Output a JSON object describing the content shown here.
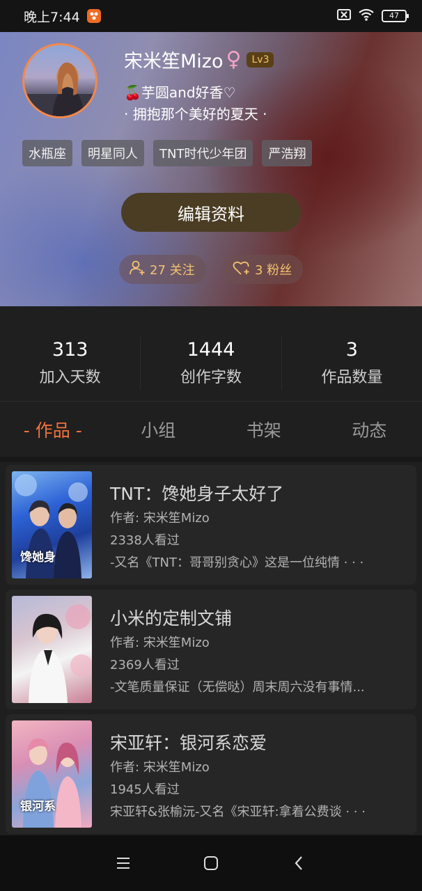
{
  "status": {
    "time": "晚上7:44",
    "battery": "47"
  },
  "profile": {
    "name": "宋米笙Mizo",
    "gender_symbol": "♀",
    "level": "Lv3",
    "signature_line1": "🍒芋圆and好香♡",
    "signature_line2": "· 拥抱那个美好的夏天 ·",
    "tags": [
      "水瓶座",
      "明星同人",
      "TNT时代少年团",
      "严浩翔"
    ],
    "edit_label": "编辑资料",
    "following": "27 关注",
    "fans": "3 粉丝"
  },
  "stats": [
    {
      "value": "313",
      "label": "加入天数"
    },
    {
      "value": "1444",
      "label": "创作字数"
    },
    {
      "value": "3",
      "label": "作品数量"
    }
  ],
  "tabs": [
    {
      "label": "- 作品 -",
      "active": true
    },
    {
      "label": "小组",
      "active": false
    },
    {
      "label": "书架",
      "active": false
    },
    {
      "label": "动态",
      "active": false
    }
  ],
  "works": [
    {
      "title": "TNT：馋她身子太好了",
      "author": "作者: 宋米笙Mizo",
      "views": "2338人看过",
      "description": "-又名《TNT：哥哥别贪心》这是一位纯情 · · ·"
    },
    {
      "title": "小米的定制文铺",
      "author": "作者: 宋米笙Mizo",
      "views": "2369人看过",
      "description": "-文笔质量保证（无偿哒）周末周六没有事情..."
    },
    {
      "title": "宋亚轩：银河系恋爱",
      "author": "作者: 宋米笙Mizo",
      "views": "1945人看过",
      "description": "宋亚轩&张榆沅-又名《宋亚轩:拿着公费谈 · · ·"
    }
  ],
  "colors": {
    "accent": "#f0733c",
    "gold": "#f4c36e",
    "level_bg": "#5b3f16"
  }
}
